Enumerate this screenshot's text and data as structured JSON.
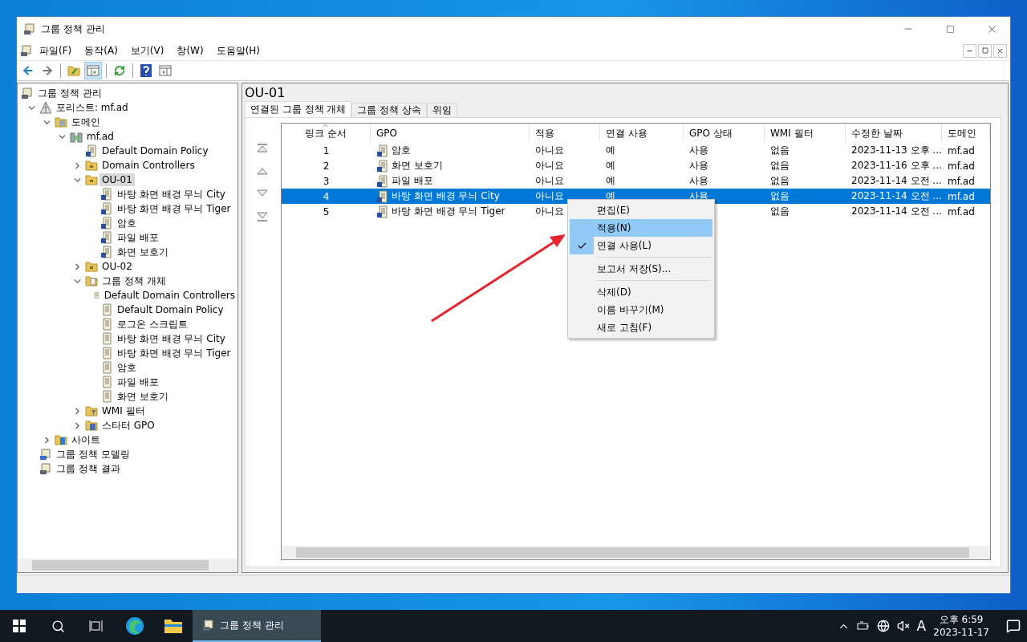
{
  "window": {
    "title": "그룹 정책 관리"
  },
  "menu_bar": [
    {
      "label": "파일(F)"
    },
    {
      "label": "동작(A)"
    },
    {
      "label": "보기(V)"
    },
    {
      "label": "창(W)"
    },
    {
      "label": "도움말(H)"
    }
  ],
  "toolbar": [
    {
      "kind": "back",
      "pressed": false
    },
    {
      "kind": "forward",
      "pressed": false
    },
    {
      "kind": "sep"
    },
    {
      "kind": "up",
      "pressed": false
    },
    {
      "kind": "tree",
      "pressed": true
    },
    {
      "kind": "sep"
    },
    {
      "kind": "refresh",
      "pressed": false
    },
    {
      "kind": "sep"
    },
    {
      "kind": "help",
      "pressed": false
    },
    {
      "kind": "pane",
      "pressed": false
    }
  ],
  "tree": [
    {
      "label": "그룹 정책 관리",
      "kind": "console",
      "selected": false,
      "children": [
        {
          "label": "포리스트: mf.ad",
          "kind": "forest",
          "expanded": true,
          "selected": false,
          "children": [
            {
              "label": "도메인",
              "kind": "domains",
              "expanded": true,
              "selected": false,
              "children": [
                {
                  "label": "mf.ad",
                  "kind": "domain",
                  "expanded": true,
                  "selected": false,
                  "children": [
                    {
                      "label": "Default Domain Policy",
                      "kind": "gpo-link",
                      "selected": false
                    },
                    {
                      "label": "Domain Controllers",
                      "kind": "ou",
                      "expanded": false,
                      "selected": false
                    },
                    {
                      "label": "OU-01",
                      "kind": "ou",
                      "expanded": true,
                      "selected": true,
                      "children": [
                        {
                          "label": "바탕 화면 배경 무늬 City",
                          "kind": "gpo-link",
                          "selected": false
                        },
                        {
                          "label": "바탕 화면 배경 무늬 Tiger",
                          "kind": "gpo-link",
                          "selected": false
                        },
                        {
                          "label": "암호",
                          "kind": "gpo-link",
                          "selected": false
                        },
                        {
                          "label": "파일 배포",
                          "kind": "gpo-link",
                          "selected": false
                        },
                        {
                          "label": "화면 보호기",
                          "kind": "gpo-link",
                          "selected": false
                        }
                      ]
                    },
                    {
                      "label": "OU-02",
                      "kind": "ou",
                      "expanded": false,
                      "selected": false
                    },
                    {
                      "label": "그룹 정책 개체",
                      "kind": "gpo-folder",
                      "expanded": true,
                      "selected": false,
                      "children": [
                        {
                          "label": "Default Domain Controllers",
                          "kind": "gpo",
                          "selected": false
                        },
                        {
                          "label": "Default Domain Policy",
                          "kind": "gpo",
                          "selected": false
                        },
                        {
                          "label": "로그온 스크립트",
                          "kind": "gpo",
                          "selected": false
                        },
                        {
                          "label": "바탕 화면 배경 무늬 City",
                          "kind": "gpo",
                          "selected": false
                        },
                        {
                          "label": "바탕 화면 배경 무늬 Tiger",
                          "kind": "gpo",
                          "selected": false
                        },
                        {
                          "label": "암호",
                          "kind": "gpo",
                          "selected": false
                        },
                        {
                          "label": "파일 배포",
                          "kind": "gpo",
                          "selected": false
                        },
                        {
                          "label": "화면 보호기",
                          "kind": "gpo",
                          "selected": false
                        }
                      ]
                    },
                    {
                      "label": "WMI 필터",
                      "kind": "wmi",
                      "expanded": false,
                      "selected": false
                    },
                    {
                      "label": "스타터 GPO",
                      "kind": "starter",
                      "expanded": false,
                      "selected": false
                    }
                  ]
                }
              ]
            },
            {
              "label": "사이트",
              "kind": "sites",
              "expanded": false,
              "selected": false
            }
          ]
        },
        {
          "label": "그룹 정책 모델링",
          "kind": "modeling",
          "selected": false
        },
        {
          "label": "그룹 정책 결과",
          "kind": "results",
          "selected": false
        }
      ]
    }
  ],
  "detail": {
    "title": "OU-01",
    "tabs": [
      {
        "label": "연결된 그룹 정책 개체",
        "selected": true
      },
      {
        "label": "그룹 정책 상속",
        "selected": false
      },
      {
        "label": "위임",
        "selected": false
      }
    ],
    "columns": [
      {
        "label": "링크 순서",
        "sorted": true
      },
      {
        "label": "GPO",
        "sorted": false
      },
      {
        "label": "적용",
        "sorted": false
      },
      {
        "label": "연결 사용",
        "sorted": false
      },
      {
        "label": "GPO 상태",
        "sorted": false
      },
      {
        "label": "WMI 필터",
        "sorted": false
      },
      {
        "label": "수정한 날짜",
        "sorted": false
      },
      {
        "label": "도메인",
        "sorted": false
      }
    ],
    "rows": [
      {
        "cells": [
          "1",
          "암호",
          "아니요",
          "예",
          "사용",
          "없음",
          "2023-11-13 오후 ...",
          "mf.ad"
        ],
        "selected": false
      },
      {
        "cells": [
          "2",
          "화면 보호기",
          "아니요",
          "예",
          "사용",
          "없음",
          "2023-11-16 오후 ...",
          "mf.ad"
        ],
        "selected": false
      },
      {
        "cells": [
          "3",
          "파일 배포",
          "아니요",
          "예",
          "사용",
          "없음",
          "2023-11-14 오전 ...",
          "mf.ad"
        ],
        "selected": false
      },
      {
        "cells": [
          "4",
          "바탕 화면 배경 무늬 City",
          "아니요",
          "예",
          "사용",
          "없음",
          "2023-11-14 오전 ...",
          "mf.ad"
        ],
        "selected": true
      },
      {
        "cells": [
          "5",
          "바탕 화면 배경 무늬 Tiger",
          "아니요",
          null,
          null,
          "없음",
          "2023-11-14 오전 ...",
          "mf.ad"
        ],
        "selected": false
      }
    ]
  },
  "context_menu": [
    {
      "kind": "item",
      "label": "편집(E)",
      "highlighted": false,
      "checked": false
    },
    {
      "kind": "item",
      "label": "적용(N)",
      "highlighted": true,
      "checked": false
    },
    {
      "kind": "item",
      "label": "연결 사용(L)",
      "highlighted": false,
      "checked": true
    },
    {
      "kind": "separator"
    },
    {
      "kind": "item",
      "label": "보고서 저장(S)...",
      "highlighted": false,
      "checked": false
    },
    {
      "kind": "separator"
    },
    {
      "kind": "item",
      "label": "삭제(D)",
      "highlighted": false,
      "checked": false
    },
    {
      "kind": "item",
      "label": "이름 바꾸기(M)",
      "highlighted": false,
      "checked": false
    },
    {
      "kind": "item",
      "label": "새로 고침(F)",
      "highlighted": false,
      "checked": false
    }
  ],
  "taskbar": {
    "app": {
      "label": "그룹 정책 관리",
      "selected": true
    },
    "tray_letter": "A",
    "time": "오후 6:59",
    "date": "2023-11-17"
  }
}
